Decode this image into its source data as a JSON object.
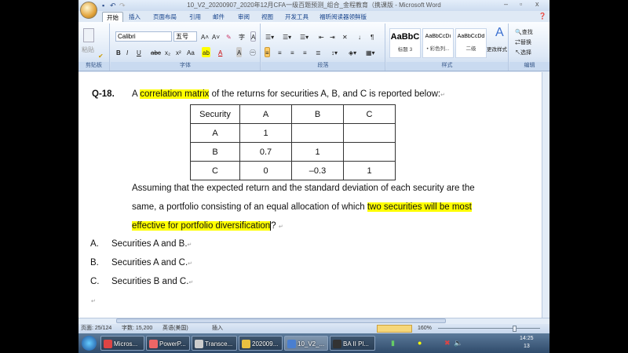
{
  "window": {
    "title": "10_V2_20200907_2020年12月CFA一级百题预测_组合_金程教育（携课版 - Microsoft Word",
    "minimize": "–",
    "maximize": "▫",
    "close": "x"
  },
  "tabs": [
    "开始",
    "插入",
    "页面布局",
    "引用",
    "邮件",
    "审阅",
    "视图",
    "开发工具",
    "福昕阅读器领鲜版"
  ],
  "ribbon": {
    "clipboard": {
      "label": "剪贴板",
      "paste": "粘贴"
    },
    "font": {
      "label": "字体",
      "font_name": "Calibri",
      "font_size": "五号",
      "bold": "B",
      "italic": "I",
      "underline": "U",
      "strike": "abc",
      "sub": "x₂",
      "sup": "x²",
      "case": "Aa",
      "grow": "A˄",
      "shrink": "A˅",
      "font_color": "A",
      "char_shade": "A",
      "enclose": "㊀"
    },
    "paragraph": {
      "label": "段落"
    },
    "styles": {
      "label": "样式",
      "items": [
        {
          "preview": "AaBbC",
          "name": "标题 3"
        },
        {
          "preview": "AaBbCcDı",
          "name": "• 彩色列..."
        },
        {
          "preview": "AaBbCcDd",
          "name": "二级"
        }
      ],
      "change": "更改样式"
    },
    "editing": {
      "label": "编辑",
      "find": "查找",
      "replace": "替换",
      "select": "选择"
    }
  },
  "document": {
    "question_no": "Q-18.",
    "intro_pre": "A ",
    "intro_hl": "correlation matrix",
    "intro_post": " of the returns for securities A, B, and C is reported below:",
    "table": {
      "header": [
        "Security",
        "A",
        "B",
        "C"
      ],
      "rows": [
        [
          "A",
          "1",
          "",
          ""
        ],
        [
          "B",
          "0.7",
          "1",
          ""
        ],
        [
          "C",
          "0",
          "–0.3",
          "1"
        ]
      ]
    },
    "para_line1": "Assuming that the expected return and the standard deviation of each security are the",
    "para_line2_pre": "same, a portfolio consisting of an equal allocation of which ",
    "para_line2_hl": "two securities will be most",
    "para_line3_hl": "effective for portfolio diversification",
    "para_line3_post": "?",
    "options": [
      {
        "letter": "A.",
        "text": "Securities A and B."
      },
      {
        "letter": "B.",
        "text": "Securities A and C."
      },
      {
        "letter": "C.",
        "text": "Securities B and C."
      }
    ],
    "para_mark": "↵"
  },
  "status": {
    "page": "页面: 25/124",
    "words": "字数: 15,200",
    "lang": "英语(美国)",
    "mode": "插入",
    "zoom": "160%"
  },
  "taskbar": {
    "items": [
      "Micros...",
      "PowerP...",
      "Transce...",
      "202009...",
      "10_V2_...",
      "BA II Pl..."
    ],
    "time": "14:25",
    "date": "13"
  }
}
